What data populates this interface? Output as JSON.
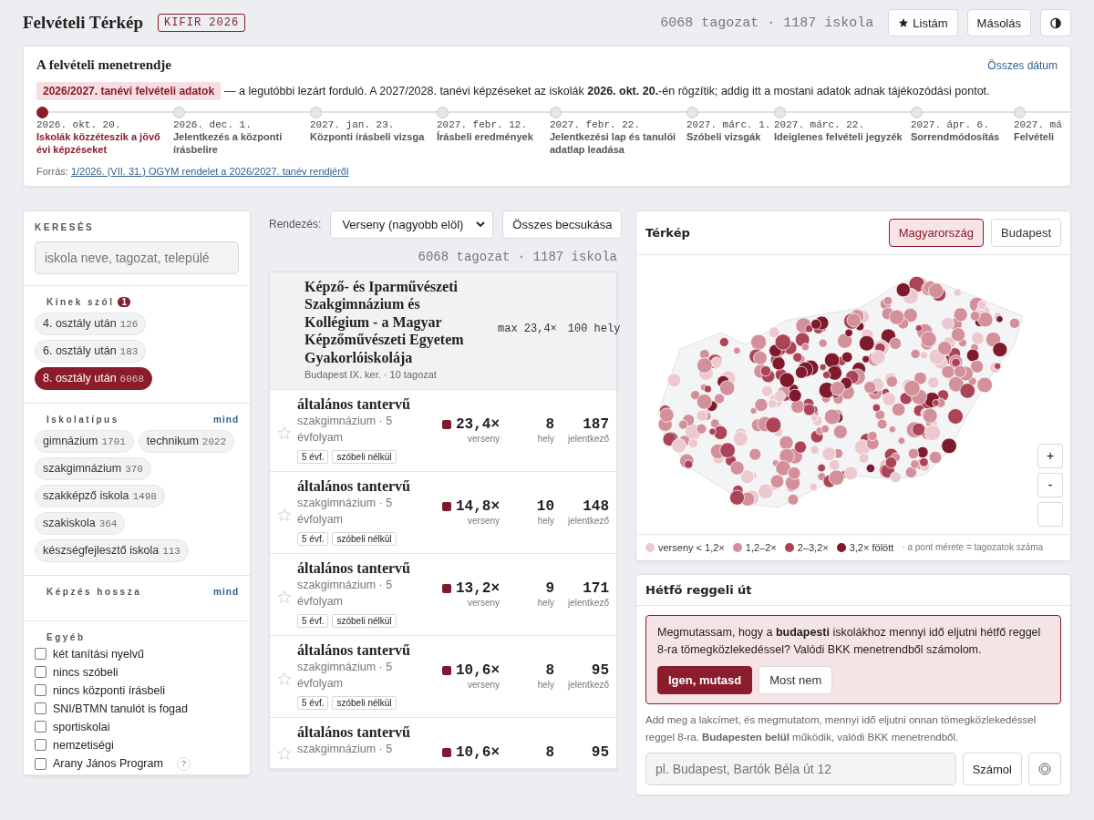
{
  "header": {
    "title": "Felvételi Térkép",
    "badge": "KIFIR 2026",
    "count": "6068 tagozat · 1187 iskola",
    "buttons": [
      {
        "kind": "star",
        "label": "Listám"
      },
      {
        "kind": "text",
        "label": "Másolás"
      },
      {
        "kind": "theme"
      }
    ]
  },
  "timeline": {
    "title": "A felvételi menetrendje",
    "link": "Összes dátum",
    "tag": "2026/2027. tanévi felvételi adatok",
    "note": "— a legutóbbi lezárt forduló. A 2027/2028. tanévi képzéseket az iskolák **2026. okt. 20.**-én rögzítik; addig itt a mostani adatok adnak tájékozódási pontot.",
    "milestones": [
      {
        "date": "2026. okt. 20.",
        "label": "Iskolák közzéteszik a jövő évi képzéseket",
        "selected": true
      },
      {
        "date": "2026. dec. 1.",
        "label": "Jelentkezés a központi írásbelire",
        "selected": false
      },
      {
        "date": "2027. jan. 23.",
        "label": "Központi írásbeli vizsga",
        "selected": false
      },
      {
        "date": "2027. febr. 12.",
        "label": "Írásbeli eredmények",
        "selected": false
      },
      {
        "date": "2027. febr. 22.",
        "label": "Jelentkezési lap és tanulói adatlap leadása",
        "selected": false
      },
      {
        "date": "2027. márc. 1.",
        "label": "Szóbeli vizsgák",
        "selected": false
      },
      {
        "date": "2027. márc. 22.",
        "label": "Ideiglenes felvételi jegyzék",
        "selected": false
      },
      {
        "date": "2027. ápr. 6.",
        "label": "Sorrendmódosítás",
        "selected": false
      },
      {
        "date": "2027. má",
        "label": "Felvételi",
        "selected": false
      }
    ],
    "source_label": "Forrás:",
    "source_link": "1/2026. (VII. 31.) OGYM rendelet a 2026/2027. tanév rendjéről"
  },
  "sidebar": {
    "search_label": "KERESÉS",
    "search_placeholder": "iskola neve, tagozat, települé",
    "groups": [
      {
        "kind": "chips",
        "title": "Kinek szól",
        "badge": "1",
        "chips": [
          {
            "label": "4. osztály után",
            "count": "126",
            "selected": false
          },
          {
            "label": "6. osztály után",
            "count": "183",
            "selected": false
          },
          {
            "label": "8. osztály után",
            "count": "6068",
            "selected": true
          }
        ]
      },
      {
        "kind": "chips",
        "title": "Iskolatípus",
        "link": "mind",
        "chips": [
          {
            "label": "gimnázium",
            "count": "1701",
            "selected": false
          },
          {
            "label": "technikum",
            "count": "2022",
            "selected": false
          },
          {
            "label": "szakgimnázium",
            "count": "370",
            "selected": false
          },
          {
            "label": "szakképző iskola",
            "count": "1498",
            "selected": false
          },
          {
            "label": "szakiskola",
            "count": "364",
            "selected": false
          },
          {
            "label": "készségfejlesztő iskola",
            "count": "113",
            "selected": false
          }
        ]
      },
      {
        "kind": "chips",
        "title": "Képzés hossza",
        "link": "mind"
      },
      {
        "kind": "checks",
        "title": "Egyéb",
        "checks": [
          {
            "label": "két tanítási nyelvű",
            "checked": false
          },
          {
            "label": "nincs szóbeli",
            "checked": false
          },
          {
            "label": "nincs központi írásbeli",
            "checked": false
          },
          {
            "label": "SNI/BTMN tanulót is fogad",
            "checked": false
          },
          {
            "label": "sportiskolai",
            "checked": false
          },
          {
            "label": "nemzetiségi",
            "checked": false
          },
          {
            "label": "Arany János Program",
            "checked": false,
            "help": "?"
          }
        ]
      }
    ]
  },
  "results": {
    "sort_label": "Rendezés:",
    "sort_value": "Verseny (nagyobb elöl)",
    "collapse_button": "Összes becsukása",
    "count": "6068 tagozat · 1187 iskola",
    "school": {
      "name": "Képző- és Iparművészeti Szakgimnázium és Kollégium - a Magyar Képzőművészeti Egyetem Gyakorlóiskolája",
      "meta": "Budapest IX. ker. · 10 tagozat",
      "max": "max 23,4×",
      "places": "100 hely"
    },
    "programs": [
      {
        "name": "általános tantervű",
        "type": "szakgimnázium · 5 évfolyam",
        "ratio": "23,4×",
        "color": "#7d1a2b",
        "places": "8",
        "applicants": "187",
        "labels": [
          "verseny",
          "hely",
          "jelentkező"
        ],
        "tags": [
          "5 évf.",
          "szóbeli nélkül"
        ],
        "starred": false
      },
      {
        "name": "általános tantervű",
        "type": "szakgimnázium · 5 évfolyam",
        "ratio": "14,8×",
        "color": "#7d1a2b",
        "places": "10",
        "applicants": "148",
        "labels": [
          "verseny",
          "hely",
          "jelentkező"
        ],
        "tags": [
          "5 évf.",
          "szóbeli nélkül"
        ],
        "starred": false
      },
      {
        "name": "általános tantervű",
        "type": "szakgimnázium · 5 évfolyam",
        "ratio": "13,2×",
        "color": "#7d1a2b",
        "places": "9",
        "applicants": "171",
        "labels": [
          "verseny",
          "hely",
          "jelentkező"
        ],
        "tags": [
          "5 évf.",
          "szóbeli nélkül"
        ],
        "starred": false
      },
      {
        "name": "általános tantervű",
        "type": "szakgimnázium · 5 évfolyam",
        "ratio": "10,6×",
        "color": "#7d1a2b",
        "places": "8",
        "applicants": "95",
        "labels": [
          "verseny",
          "hely",
          "jelentkező"
        ],
        "tags": [
          "5 évf.",
          "szóbeli nélkül"
        ],
        "starred": false
      },
      {
        "name": "általános tantervű",
        "type": "szakgimnázium · 5",
        "ratio": "10,6×",
        "color": "#7d1a2b",
        "places": "8",
        "applicants": "95",
        "starred": false
      }
    ]
  },
  "map": {
    "title": "Térkép",
    "toggles": [
      {
        "label": "Magyarország",
        "selected": true
      },
      {
        "label": "Budapest",
        "selected": false
      }
    ],
    "zoom": [
      "+",
      "-"
    ],
    "extra_map_control": true,
    "legend": [
      {
        "label": "verseny < 1,2×",
        "color": "#ecc9cf"
      },
      {
        "label": "1,2–2×",
        "color": "#d3909b"
      },
      {
        "label": "2–3,2×",
        "color": "#ab4456"
      },
      {
        "label": "3,2× fölött",
        "color": "#7d1a2b"
      }
    ],
    "legend_note": "· a pont mérete = tagozatok száma"
  },
  "route": {
    "title": "Hétfő reggeli út",
    "prompt": "Megmutassam, hogy a **budapesti** iskolákhoz mennyi idő eljutni hétfő reggel 8-ra tömegközlekedéssel? Valódi BKK menetrendből számolom.",
    "buttons": [
      {
        "kind": "primary",
        "label": "Igen, mutasd"
      },
      {
        "kind": "secondary",
        "label": "Most nem"
      }
    ],
    "help": "Add meg a lakcímet, és megmutatom, mennyi idő eljutni onnan tömegközlekedéssel reggel 8-ra. **Budapesten belül** működik, valódi BKK menetrendből.",
    "placeholder": "pl. Budapest, Bartók Béla út 12",
    "submit": "Számol"
  }
}
